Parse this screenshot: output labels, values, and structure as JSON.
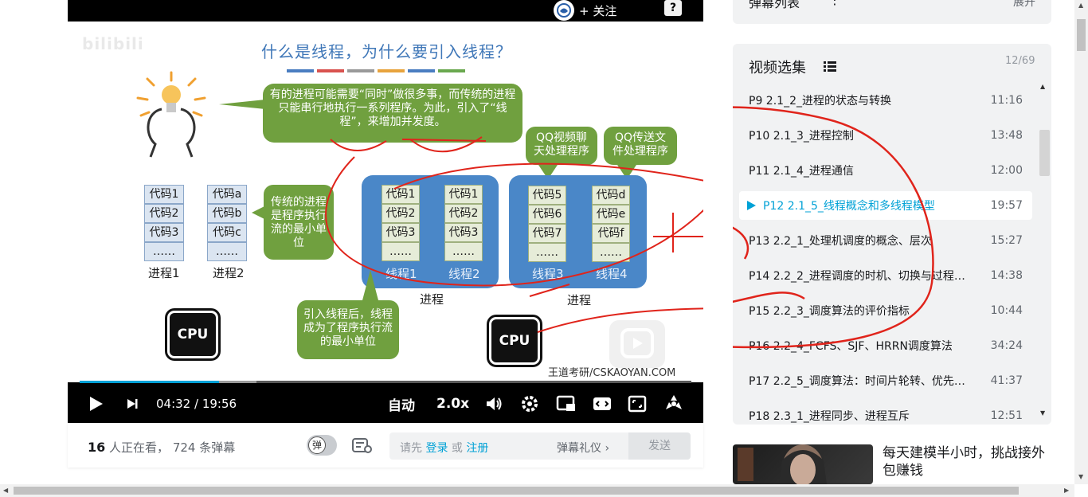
{
  "player": {
    "follow_label": "+ 关注",
    "help_label": "?",
    "slide": {
      "watermark": "bilibili",
      "title": "什么是线程，为什么要引入线程？",
      "title_bar_colors": [
        "#4a7dc1",
        "#d9534f",
        "#9a9a9a",
        "#e8a33d",
        "#4a7dc1",
        "#6aa84f"
      ],
      "top_bubble": "有的进程可能需要“同时”做很多事，而传统的进程只能串行地执行一系列程序。为此，引入了“线程”，来增加并发度。",
      "qq_video_bubble": "QQ视频聊天处理程序",
      "qq_file_bubble": "QQ传送文件处理程序",
      "traditional_bubble": "传统的进程是程序执行流的最小单位",
      "thread_bubble": "引入线程后，线程成为了程序执行流的最小单位",
      "process1": {
        "cells": [
          "代码1",
          "代码2",
          "代码3",
          "……"
        ],
        "label": "进程1"
      },
      "process2": {
        "cells": [
          "代码a",
          "代码b",
          "代码c",
          "……"
        ],
        "label": "进程2"
      },
      "group_a": {
        "label": "进程",
        "thread1": {
          "cells": [
            "代码1",
            "代码2",
            "代码3",
            "……"
          ],
          "label": "线程1"
        },
        "thread2": {
          "cells": [
            "代码1",
            "代码2",
            "代码3",
            "……"
          ],
          "label": "线程2"
        }
      },
      "group_b": {
        "label": "进程",
        "thread3": {
          "cells": [
            "代码5",
            "代码6",
            "代码7",
            "……"
          ],
          "label": "线程3"
        },
        "thread4": {
          "cells": [
            "代码d",
            "代码e",
            "代码f",
            "……"
          ],
          "label": "线程4"
        }
      },
      "cpu_label": "CPU",
      "footer": "王道考研/CSKAOYAN.COM",
      "annotation_color": "#e0241b"
    },
    "progress": {
      "played_fraction": 0.228,
      "buffered_fraction": 0.289,
      "color": "#00a1d6"
    },
    "controls": {
      "time_current": "04:32",
      "time_separator": " / ",
      "time_total": "19:56",
      "quality_label": "自动",
      "speed_label": "2.0x"
    }
  },
  "below_bar": {
    "viewer_count": "16",
    "viewer_text": " 人正在看，",
    "danmaku_count_text": " 724 条弹幕",
    "danmaku_toggle_label": "弹",
    "input_prefix": "请先 ",
    "login_label": "登录",
    "or_label": " 或 ",
    "register_label": "注册",
    "etiquette_label": "弹幕礼仪 ›",
    "send_label": "发送"
  },
  "sidebar": {
    "danmaku_list_title": "弹幕列表",
    "danmaku_list_more": "⋮",
    "danmaku_list_expand": "展开",
    "episodes_title": "视频选集",
    "episodes_count": "12/69",
    "episodes": [
      {
        "title": "P9  2.1_2_进程的状态与转换",
        "duration": "11:16",
        "active": false
      },
      {
        "title": "P10  2.1_3_进程控制",
        "duration": "13:48",
        "active": false
      },
      {
        "title": "P11  2.1_4_进程通信",
        "duration": "12:00",
        "active": false
      },
      {
        "title": "P12  2.1_5_线程概念和多线程模型",
        "duration": "19:57",
        "active": true
      },
      {
        "title": "P13  2.2_1_处理机调度的概念、层次",
        "duration": "15:27",
        "active": false
      },
      {
        "title": "P14  2.2_2_进程调度的时机、切换与过程…",
        "duration": "14:38",
        "active": false
      },
      {
        "title": "P15  2.2_3_调度算法的评价指标",
        "duration": "10:44",
        "active": false
      },
      {
        "title": "P16  2.2_4_FCFS、SJF、HRRN调度算法",
        "duration": "34:24",
        "active": false
      },
      {
        "title": "P17  2.2_5_调度算法：时间片轮转、优先…",
        "duration": "41:37",
        "active": false
      },
      {
        "title": "P18  2.3_1_进程同步、进程互斥",
        "duration": "12:51",
        "active": false
      }
    ],
    "recommendation": {
      "title": "每天建模半小时，挑战接外包赚钱"
    }
  }
}
